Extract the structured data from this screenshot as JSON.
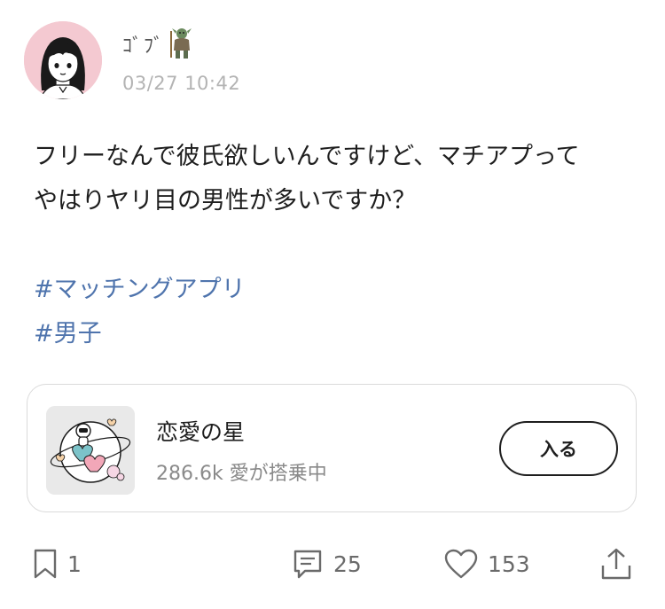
{
  "post": {
    "author": {
      "name": "ｺﾞﾌﾞ",
      "badge_icon": "troll-icon",
      "avatar_icon": "girl-avatar-icon",
      "avatar_bg": "#f4c9d1"
    },
    "timestamp": "03/27 10:42",
    "body": "フリーなんで彼氏欲しいんですけど、マチアプって\nやはりヤリ目の男性が多いですか？",
    "hashtags": [
      "#マッチングアプリ",
      "#男子"
    ]
  },
  "community": {
    "name": "恋愛の星",
    "stat": "286.6k 愛が搭乗中",
    "join_label": "入る",
    "icon": "love-planet-icon"
  },
  "actions": {
    "bookmark": {
      "icon": "bookmark-icon",
      "count": "1"
    },
    "comment": {
      "icon": "comment-icon",
      "count": "25"
    },
    "like": {
      "icon": "heart-icon",
      "count": "153"
    },
    "share": {
      "icon": "share-icon"
    }
  },
  "colors": {
    "hashtag": "#4f74ad",
    "timestamp": "#b3b3b3",
    "card_border": "#dadada"
  }
}
